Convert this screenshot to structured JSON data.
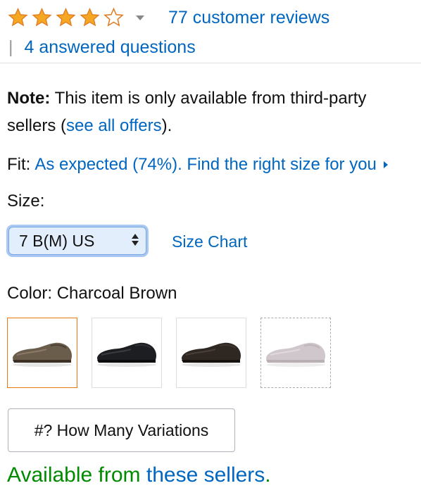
{
  "rating": {
    "value": 4,
    "max": 5,
    "reviews_link": "77 customer reviews",
    "answered_link": "4 answered questions",
    "separator": "|",
    "icons": [
      "star-full-icon",
      "star-empty-icon",
      "chevron-down-icon"
    ]
  },
  "note": {
    "label": "Note:",
    "text": " This item is only available from third-party sellers (",
    "link": "see all offers",
    "suffix": ")."
  },
  "fit": {
    "label": "Fit:",
    "link": "As expected (74%). Find the right size for you",
    "icon": "caret-right-icon"
  },
  "size": {
    "label": "Size:",
    "selected": "7 B(M) US",
    "chart_link": "Size Chart"
  },
  "color": {
    "label": "Color: Charcoal Brown",
    "swatches": [
      {
        "name": "charcoal-brown",
        "selected": true,
        "available": true
      },
      {
        "name": "black",
        "selected": false,
        "available": true
      },
      {
        "name": "dark-brown",
        "selected": false,
        "available": true
      },
      {
        "name": "light-grey",
        "selected": false,
        "available": false
      }
    ]
  },
  "variations_button": "#? How Many Variations",
  "availability": {
    "prefix": "Available from ",
    "link": "these sellers",
    "suffix": "."
  },
  "colors": {
    "link": "#0066c0",
    "star": "#f5a623",
    "star_stroke": "#de7921",
    "selected_border": "#e47911",
    "available_green": "#008a00"
  }
}
